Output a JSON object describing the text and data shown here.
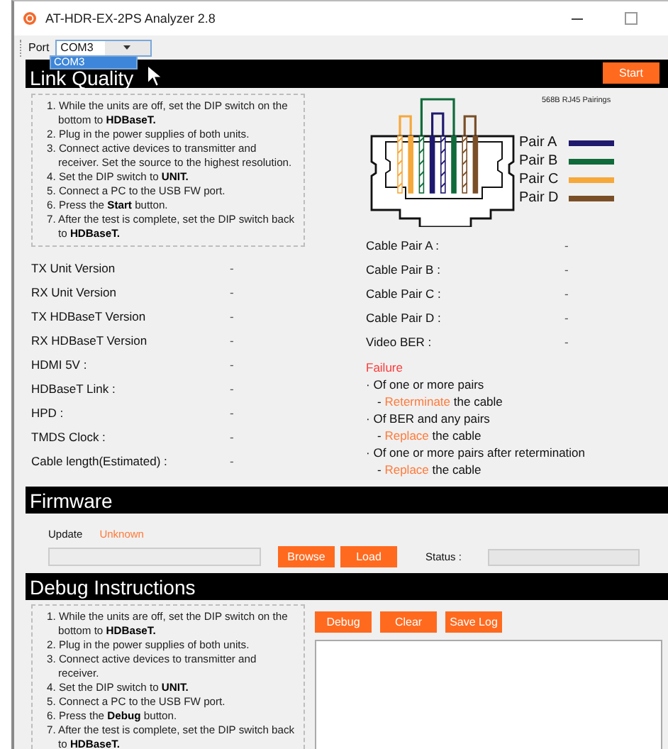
{
  "window": {
    "title": "AT-HDR-EX-2PS Analyzer 2.8"
  },
  "toolbar": {
    "port_label": "Port",
    "port_value": "COM3",
    "dropdown_options": [
      {
        "label": "COM3",
        "selected": true
      }
    ]
  },
  "link_quality": {
    "title": "Link Quality",
    "start_button": "Start",
    "instructions": [
      "1. While the units are off, set the DIP switch on the bottom to **HDBaseT.**",
      "2. Plug in the power supplies of both units.",
      "3. Connect active devices to transmitter and receiver. Set the source to the highest resolution.",
      "4. Set the DIP switch to **UNIT.**",
      "5. Connect a PC to the USB FW port.",
      "6. Press the **Start** button.",
      "7. After the test is complete, set the DIP switch back to **HDBaseT.**"
    ],
    "diagram_title": "568B RJ45 Pairings",
    "pairs": [
      {
        "label": "Pair A",
        "color": "#1f1a6e"
      },
      {
        "label": "Pair B",
        "color": "#0f6b3a"
      },
      {
        "label": "Pair C",
        "color": "#f6a83a"
      },
      {
        "label": "Pair D",
        "color": "#7a4f28"
      }
    ],
    "unit_fields": [
      {
        "label": "TX Unit Version",
        "value": "-"
      },
      {
        "label": "RX Unit Version",
        "value": "-"
      },
      {
        "label": "TX HDBaseT Version",
        "value": "-"
      },
      {
        "label": "RX HDBaseT Version",
        "value": "-"
      },
      {
        "label": "HDMI 5V :",
        "value": "-"
      },
      {
        "label": "HDBaseT Link :",
        "value": "-"
      },
      {
        "label": "HPD :",
        "value": "-"
      },
      {
        "label": "TMDS Clock :",
        "value": "-"
      },
      {
        "label": "Cable length(Estimated) :",
        "value": "-"
      }
    ],
    "cable_fields": [
      {
        "label": "Cable Pair A :",
        "value": "-"
      },
      {
        "label": "Cable Pair B :",
        "value": "-"
      },
      {
        "label": "Cable Pair C :",
        "value": "-"
      },
      {
        "label": "Cable Pair D :",
        "value": "-"
      },
      {
        "label": "Video BER :",
        "value": "-"
      }
    ],
    "failure": {
      "title": "Failure",
      "bullet": "·",
      "dash": "-",
      "items": [
        {
          "condition": "Of one or more pairs",
          "action": "Reterminate",
          "rest": "the cable"
        },
        {
          "condition": "Of BER and any pairs",
          "action": "Replace",
          "rest": "the cable"
        },
        {
          "condition": "Of one or more pairs after retermination",
          "action": "Replace",
          "rest": "the cable"
        }
      ]
    }
  },
  "firmware": {
    "title": "Firmware",
    "update_label": "Update",
    "update_status": "Unknown",
    "browse_button": "Browse",
    "load_button": "Load",
    "status_label": "Status :"
  },
  "debug": {
    "title": "Debug Instructions",
    "instructions": [
      "1. While the units are off, set the DIP switch on the bottom to **HDBaseT.**",
      "2. Plug in the power supplies of both units.",
      "3. Connect active devices to transmitter and receiver.",
      "4. Set the DIP switch to **UNIT.**",
      "5. Connect a PC to the USB FW port.",
      "6. Press the **Debug**  button.",
      "7. After the test is complete, set the DIP switch back to **HDBaseT.**"
    ],
    "buttons": [
      "Debug",
      "Clear",
      "Save Log"
    ]
  }
}
